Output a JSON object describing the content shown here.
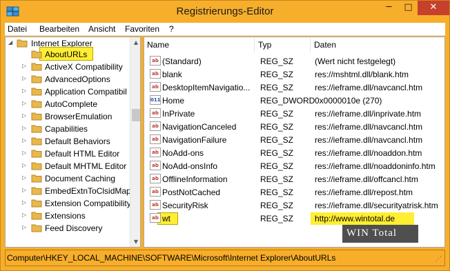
{
  "window": {
    "title": "Registrierungs-Editor",
    "minimize_glyph": "─",
    "maximize_glyph": "□",
    "close_glyph": "✕"
  },
  "menu": {
    "items": [
      "Datei",
      "Bearbeiten",
      "Ansicht",
      "Favoriten",
      "?"
    ]
  },
  "tree": {
    "parent": {
      "label": "Internet Explorer",
      "expanded": true
    },
    "selected_index": 0,
    "items": [
      {
        "label": "AboutURLs",
        "has_children": false
      },
      {
        "label": "ActiveX Compatibility",
        "has_children": true
      },
      {
        "label": "AdvancedOptions",
        "has_children": true
      },
      {
        "label": "Application Compatibil",
        "has_children": true
      },
      {
        "label": "AutoComplete",
        "has_children": true
      },
      {
        "label": "BrowserEmulation",
        "has_children": true
      },
      {
        "label": "Capabilities",
        "has_children": true
      },
      {
        "label": "Default Behaviors",
        "has_children": true
      },
      {
        "label": "Default HTML Editor",
        "has_children": true
      },
      {
        "label": "Default MHTML Editor",
        "has_children": true
      },
      {
        "label": "Document Caching",
        "has_children": true
      },
      {
        "label": "EmbedExtnToClsidMap",
        "has_children": true
      },
      {
        "label": "Extension Compatibility",
        "has_children": true
      },
      {
        "label": "Extensions",
        "has_children": true
      },
      {
        "label": "Feed Discovery",
        "has_children": true
      }
    ]
  },
  "list": {
    "columns": {
      "name": "Name",
      "type": "Typ",
      "data": "Daten"
    },
    "rows": [
      {
        "name": "(Standard)",
        "type": "REG_SZ",
        "data": "(Wert nicht festgelegt)",
        "icon": "ab"
      },
      {
        "name": "blank",
        "type": "REG_SZ",
        "data": "res://mshtml.dll/blank.htm",
        "icon": "ab"
      },
      {
        "name": "DesktopItemNavigatio...",
        "type": "REG_SZ",
        "data": "res://ieframe.dll/navcancl.htm",
        "icon": "ab"
      },
      {
        "name": "Home",
        "type": "REG_DWORD",
        "data": "0x0000010e (270)",
        "icon": "bin"
      },
      {
        "name": "InPrivate",
        "type": "REG_SZ",
        "data": "res://ieframe.dll/inprivate.htm",
        "icon": "ab"
      },
      {
        "name": "NavigationCanceled",
        "type": "REG_SZ",
        "data": "res://ieframe.dll/navcancl.htm",
        "icon": "ab"
      },
      {
        "name": "NavigationFailure",
        "type": "REG_SZ",
        "data": "res://ieframe.dll/navcancl.htm",
        "icon": "ab"
      },
      {
        "name": "NoAdd-ons",
        "type": "REG_SZ",
        "data": "res://ieframe.dll/noaddon.htm",
        "icon": "ab"
      },
      {
        "name": "NoAdd-onsInfo",
        "type": "REG_SZ",
        "data": "res://ieframe.dll/noaddoninfo.htm",
        "icon": "ab"
      },
      {
        "name": "OfflineInformation",
        "type": "REG_SZ",
        "data": "res://ieframe.dll/offcancl.htm",
        "icon": "ab"
      },
      {
        "name": "PostNotCached",
        "type": "REG_SZ",
        "data": "res://ieframe.dll/repost.htm",
        "icon": "ab"
      },
      {
        "name": "SecurityRisk",
        "type": "REG_SZ",
        "data": "res://ieframe.dll/securityatrisk.htm",
        "icon": "ab"
      },
      {
        "name": "wt",
        "type": "REG_SZ",
        "data": "http://www.wintotal.de",
        "icon": "ab",
        "highlighted": true
      }
    ]
  },
  "watermark": {
    "text": "WIN Total"
  },
  "status": {
    "path": "Computer\\HKEY_LOCAL_MACHINE\\SOFTWARE\\Microsoft\\Internet Explorer\\AboutURLs",
    "background": "#f7ae2b"
  },
  "colors": {
    "accent": "#f7ae2b",
    "highlight": "#ffee33",
    "close_button": "#c7402c"
  }
}
